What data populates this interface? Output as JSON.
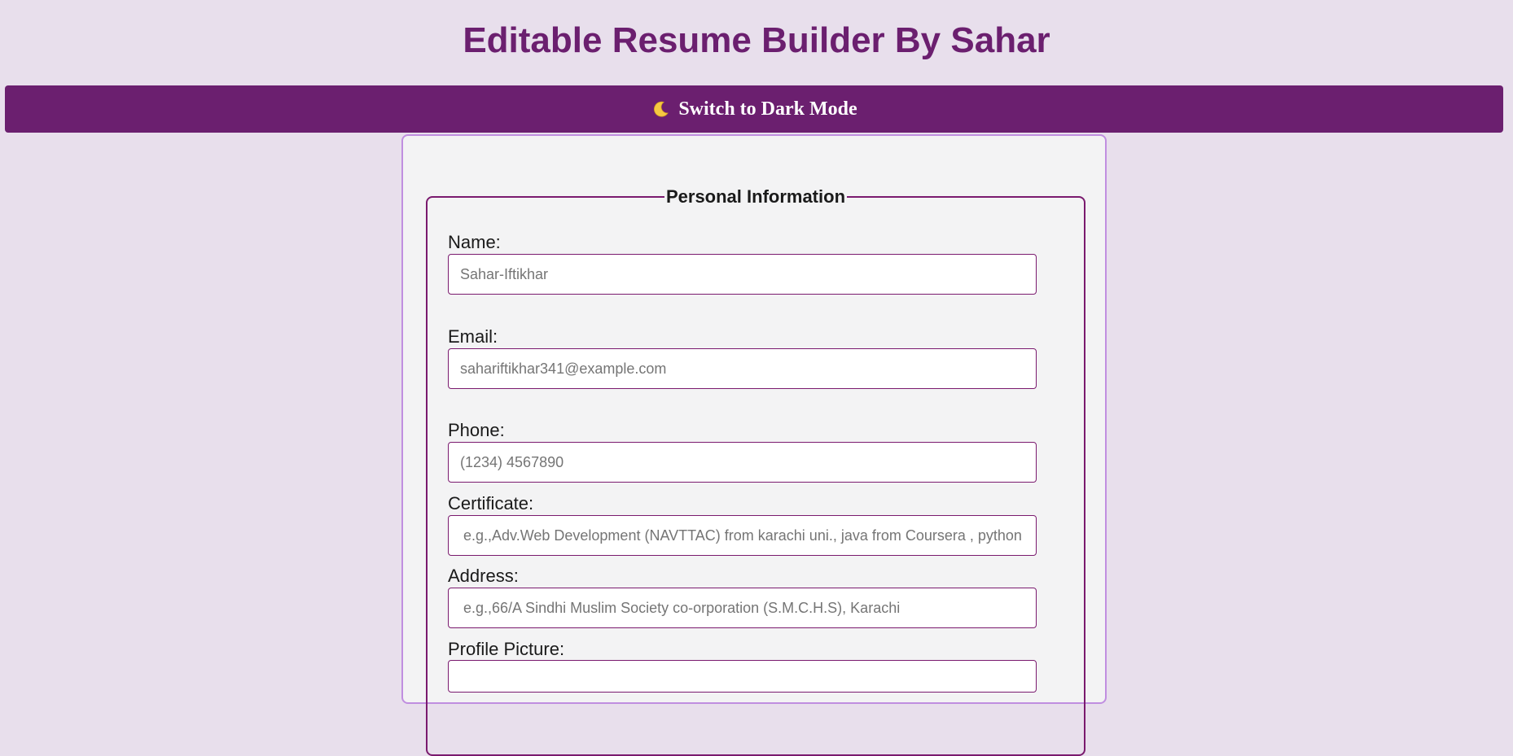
{
  "header": {
    "title": "Editable Resume Builder By Sahar"
  },
  "theme_toggle": {
    "icon": "moon-icon",
    "label": "Switch to Dark Mode"
  },
  "colors": {
    "background": "#e8dfec",
    "accent": "#6b1f6f",
    "card": "#f3f3f4",
    "card_border": "#c08ee0",
    "field_border": "#7a1a6e"
  },
  "personal_info": {
    "legend": "Personal Information",
    "fields": {
      "name": {
        "label": "Name:",
        "placeholder": "Sahar-Iftikhar"
      },
      "email": {
        "label": "Email:",
        "placeholder": "sahariftikhar341@example.com"
      },
      "phone": {
        "label": "Phone:",
        "placeholder": "(1234) 4567890"
      },
      "certificate": {
        "label": "Certificate:",
        "placeholder": "e.g.,Adv.Web Development (NAVTTAC) from karachi uni., java from Coursera , python"
      },
      "address": {
        "label": "Address:",
        "placeholder": "e.g.,66/A Sindhi Muslim Society co-orporation (S.M.C.H.S), Karachi"
      },
      "profile_picture": {
        "label": "Profile Picture:"
      }
    }
  }
}
